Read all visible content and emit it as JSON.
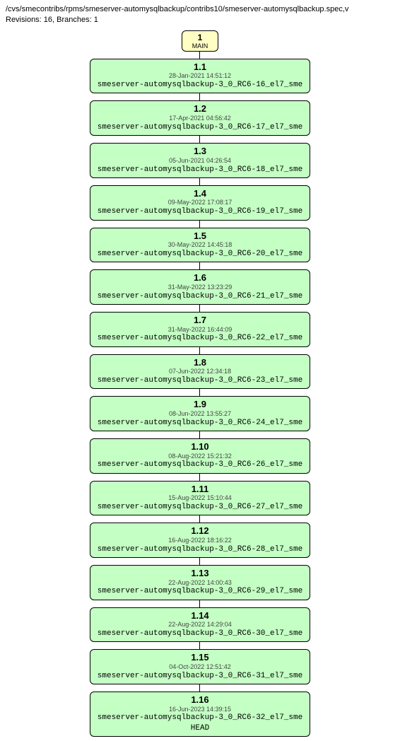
{
  "header": {
    "path": "/cvs/smecontribs/rpms/smeserver-automysqlbackup/contribs10/smeserver-automysqlbackup.spec,v",
    "meta": "Revisions: 16, Branches: 1"
  },
  "trunk": {
    "num": "1",
    "label": "MAIN"
  },
  "revisions": [
    {
      "num": "1.1",
      "date": "28-Jan-2021 14:51:12",
      "tags": [
        "smeserver-automysqlbackup-3_0_RC6-16_el7_sme"
      ]
    },
    {
      "num": "1.2",
      "date": "17-Apr-2021 04:56:42",
      "tags": [
        "smeserver-automysqlbackup-3_0_RC6-17_el7_sme"
      ]
    },
    {
      "num": "1.3",
      "date": "05-Jun-2021 04:26:54",
      "tags": [
        "smeserver-automysqlbackup-3_0_RC6-18_el7_sme"
      ]
    },
    {
      "num": "1.4",
      "date": "09-May-2022 17:08:17",
      "tags": [
        "smeserver-automysqlbackup-3_0_RC6-19_el7_sme"
      ]
    },
    {
      "num": "1.5",
      "date": "30-May-2022 14:45:18",
      "tags": [
        "smeserver-automysqlbackup-3_0_RC6-20_el7_sme"
      ]
    },
    {
      "num": "1.6",
      "date": "31-May-2022 13:23:29",
      "tags": [
        "smeserver-automysqlbackup-3_0_RC6-21_el7_sme"
      ]
    },
    {
      "num": "1.7",
      "date": "31-May-2022 16:44:09",
      "tags": [
        "smeserver-automysqlbackup-3_0_RC6-22_el7_sme"
      ]
    },
    {
      "num": "1.8",
      "date": "07-Jun-2022 12:34:18",
      "tags": [
        "smeserver-automysqlbackup-3_0_RC6-23_el7_sme"
      ]
    },
    {
      "num": "1.9",
      "date": "08-Jun-2022 13:55:27",
      "tags": [
        "smeserver-automysqlbackup-3_0_RC6-24_el7_sme"
      ]
    },
    {
      "num": "1.10",
      "date": "08-Aug-2022 15:21:32",
      "tags": [
        "smeserver-automysqlbackup-3_0_RC6-26_el7_sme"
      ]
    },
    {
      "num": "1.11",
      "date": "15-Aug-2022 15:10:44",
      "tags": [
        "smeserver-automysqlbackup-3_0_RC6-27_el7_sme"
      ]
    },
    {
      "num": "1.12",
      "date": "16-Aug-2022 18:16:22",
      "tags": [
        "smeserver-automysqlbackup-3_0_RC6-28_el7_sme"
      ]
    },
    {
      "num": "1.13",
      "date": "22-Aug-2022 14:00:43",
      "tags": [
        "smeserver-automysqlbackup-3_0_RC6-29_el7_sme"
      ]
    },
    {
      "num": "1.14",
      "date": "22-Aug-2022 14:29:04",
      "tags": [
        "smeserver-automysqlbackup-3_0_RC6-30_el7_sme"
      ]
    },
    {
      "num": "1.15",
      "date": "04-Oct-2022 12:51:42",
      "tags": [
        "smeserver-automysqlbackup-3_0_RC6-31_el7_sme"
      ]
    },
    {
      "num": "1.16",
      "date": "16-Jun-2023 14:39:15",
      "tags": [
        "smeserver-automysqlbackup-3_0_RC6-32_el7_sme",
        "HEAD"
      ]
    }
  ]
}
